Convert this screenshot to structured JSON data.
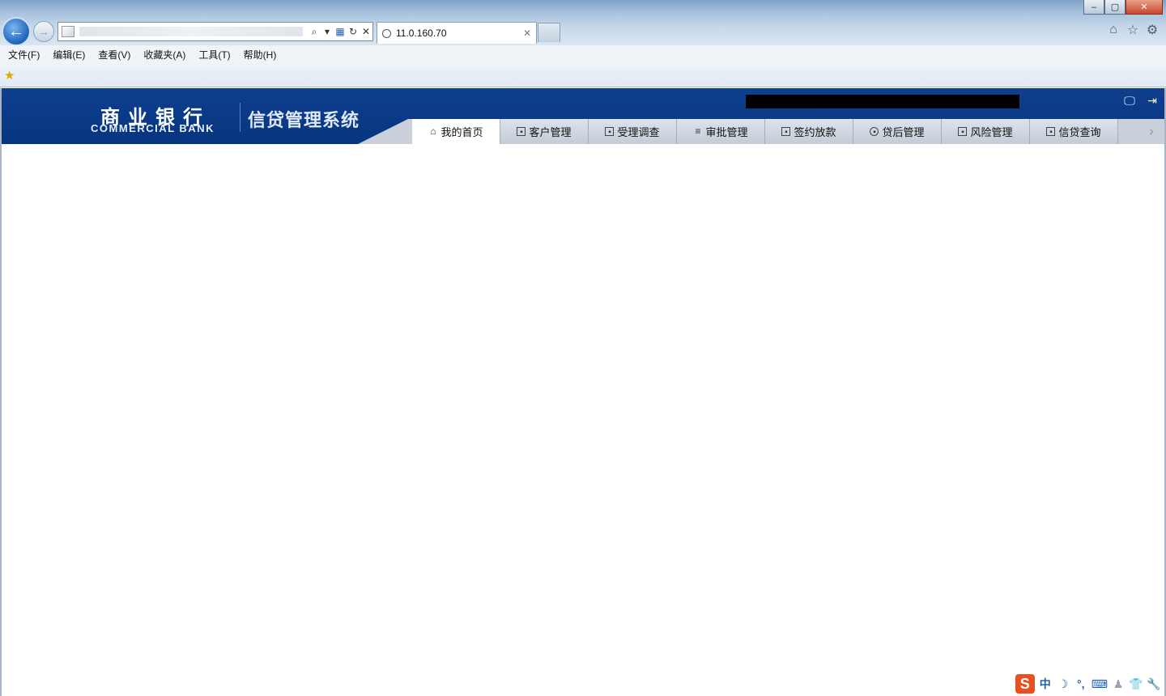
{
  "browser": {
    "window_controls": {
      "minimize": "–",
      "maximize": "▢",
      "close": "✕"
    },
    "nav": {
      "back": "←",
      "forward": "→"
    },
    "address_icons": {
      "search": "⌕",
      "dropdown": "▾",
      "compat": "▦",
      "refresh": "↻",
      "stop": "✕"
    },
    "tab": {
      "title": "11.0.160.70",
      "close": "✕"
    },
    "tools": {
      "home": "⌂",
      "favorites": "☆",
      "settings": "⚙"
    },
    "menu": [
      {
        "label": "文件(F)"
      },
      {
        "label": "编辑(E)"
      },
      {
        "label": "查看(V)"
      },
      {
        "label": "收藏夹(A)"
      },
      {
        "label": "工具(T)"
      },
      {
        "label": "帮助(H)"
      }
    ],
    "favorites_icon": "★"
  },
  "app": {
    "logo_cn": "商业银行",
    "logo_en": "COMMERCIAL BANK",
    "system_title": "信贷管理系统",
    "header_icons": {
      "desktop": "🖵",
      "logout": "⇥"
    },
    "nav_tabs": [
      {
        "label": "我的首页",
        "icon": "⌂",
        "active": true
      },
      {
        "label": "客户管理",
        "icon": "▪",
        "active": false
      },
      {
        "label": "受理调查",
        "icon": "▪",
        "active": false
      },
      {
        "label": "审批管理",
        "icon": "≡",
        "active": false
      },
      {
        "label": "签约放款",
        "icon": "▪",
        "active": false
      },
      {
        "label": "贷后管理",
        "icon": "▪",
        "active": false
      },
      {
        "label": "风险管理",
        "icon": "▪",
        "active": false
      },
      {
        "label": "信贷查询",
        "icon": "▪",
        "active": false
      }
    ],
    "nav_arrow": "›",
    "colors": {
      "header_bg": "#0e3f8e",
      "nav_bg": "#c9d0da",
      "active_tab": "#ffffff"
    }
  },
  "ime": {
    "logo": "S",
    "items": [
      "中",
      "☽",
      "°,",
      "⌨",
      "♟",
      "👕",
      "🔧"
    ]
  }
}
